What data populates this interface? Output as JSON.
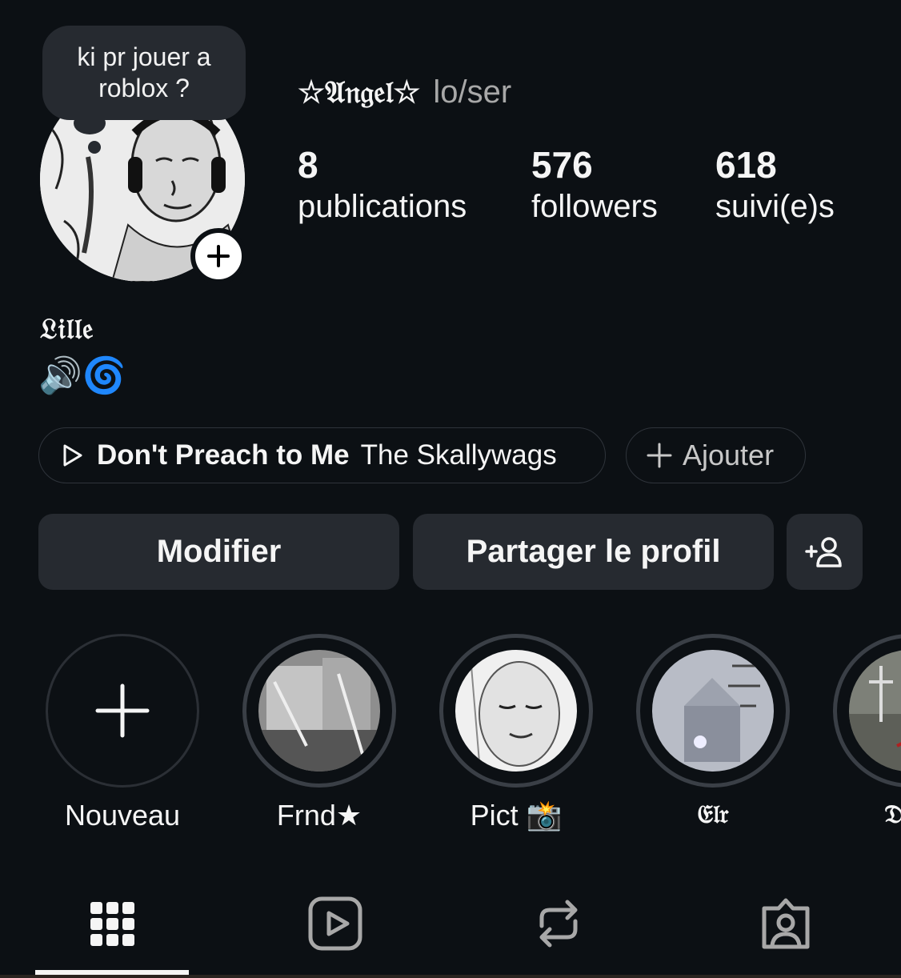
{
  "note": {
    "text": "ki pr jouer a roblox ?"
  },
  "profile": {
    "display_name": "☆𝔄𝔫𝔤𝔢𝔩☆",
    "pronouns": "lo/ser",
    "city": "𝔏𝔦𝔩𝔩𝔢",
    "bio_emoji": "🔊🌀"
  },
  "stats": [
    {
      "value": "8",
      "label": "publications"
    },
    {
      "value": "576",
      "label": "followers"
    },
    {
      "value": "618",
      "label": "suivi(e)s"
    }
  ],
  "music": {
    "song_title": "Don't Preach to Me",
    "artist": "The Skallywags",
    "add_label": "Ajouter"
  },
  "actions": {
    "edit_label": "Modifier",
    "share_label": "Partager le profil"
  },
  "highlights": [
    {
      "label": "Nouveau"
    },
    {
      "label": "Frnd★"
    },
    {
      "label": "Pict 📸"
    },
    {
      "label": "𝔈𝔩𝔯"
    },
    {
      "label": "𝔇𝔲𝔪"
    }
  ],
  "tabs": [
    "grid-icon",
    "reels-icon",
    "reposts-icon",
    "tagged-icon"
  ]
}
